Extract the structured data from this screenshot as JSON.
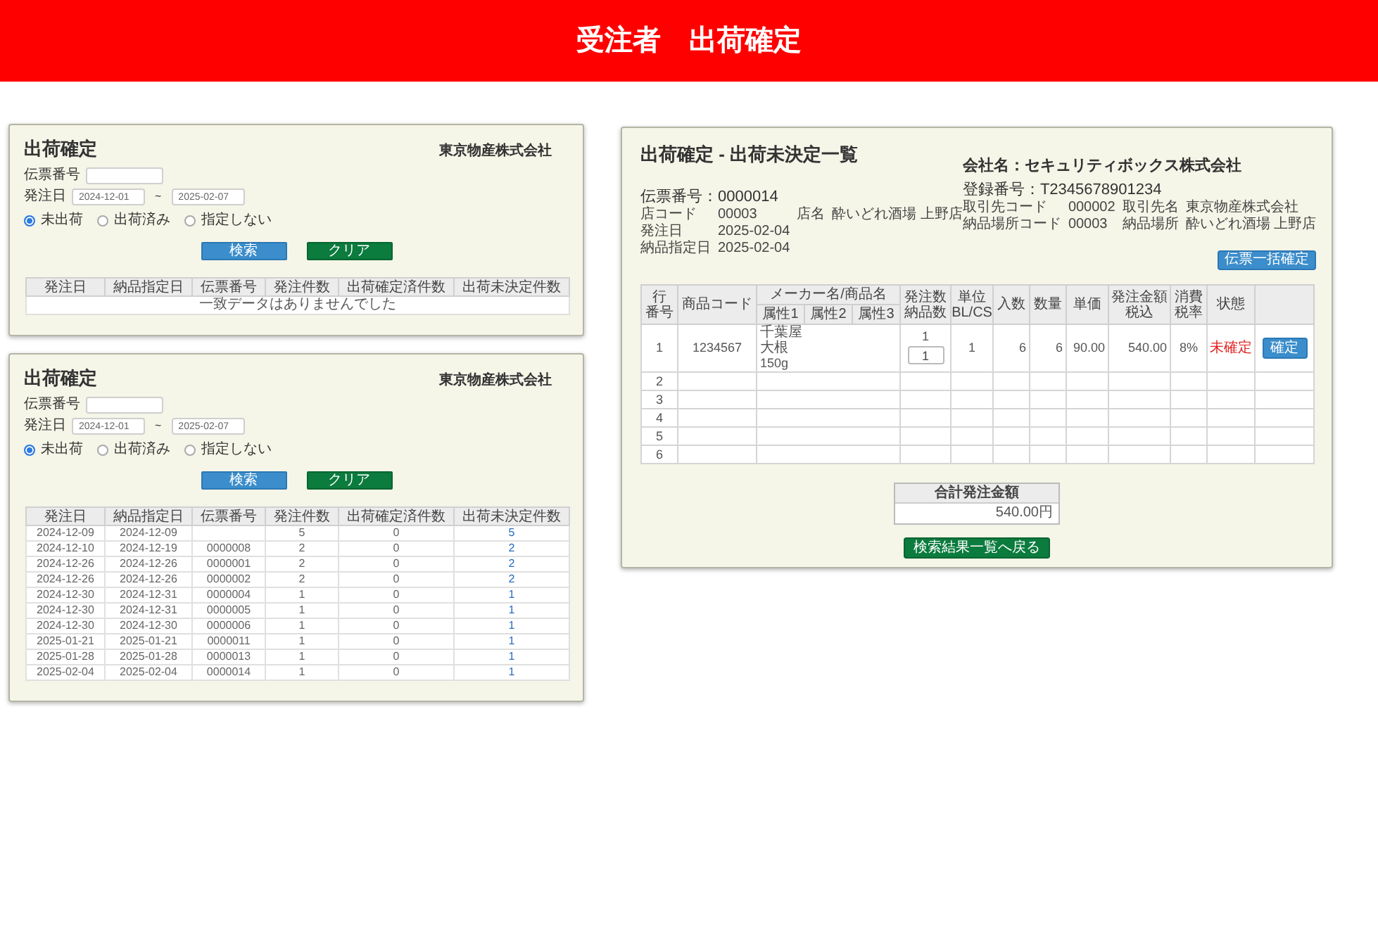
{
  "header": {
    "title": "受注者　出荷確定"
  },
  "search_screens": [
    {
      "title": "出荷確定",
      "company": "東京物産株式会社",
      "slip_field": {
        "label": "伝票番号"
      },
      "date_field": {
        "label": "発注日",
        "from": "2024-12-01",
        "separator": "~",
        "to": "2025-02-07"
      },
      "radio_options": [
        {
          "label": "未出荷",
          "selected": true
        },
        {
          "label": "出荷済み",
          "selected": false
        },
        {
          "label": "指定しない",
          "selected": false
        }
      ],
      "buttons": [
        {
          "label": "検索",
          "kind": "search"
        },
        {
          "label": "クリア",
          "kind": "clear"
        }
      ],
      "table": {
        "columns": [
          "発注日",
          "納品指定日",
          "伝票番号",
          "発注件数",
          "出荷確定済件数",
          "出荷未決定件数"
        ],
        "empty_message": "一致データはありませんでした"
      }
    },
    {
      "title": "出荷確定",
      "company": "東京物産株式会社",
      "slip_field": {
        "label": "伝票番号"
      },
      "date_field": {
        "label": "発注日",
        "from": "2024-12-01",
        "separator": "~",
        "to": "2025-02-07"
      },
      "radio_options": [
        {
          "label": "未出荷",
          "selected": true
        },
        {
          "label": "出荷済み",
          "selected": false
        },
        {
          "label": "指定しない",
          "selected": false
        }
      ],
      "buttons": [
        {
          "label": "検索",
          "kind": "search"
        },
        {
          "label": "クリア",
          "kind": "clear"
        }
      ],
      "table": {
        "columns": [
          "発注日",
          "納品指定日",
          "伝票番号",
          "発注件数",
          "出荷確定済件数",
          "出荷未決定件数"
        ],
        "rows": [
          {
            "order_date": "2024-12-09",
            "delivery_date": "2024-12-09",
            "order_count": "5",
            "confirmed_count": "0",
            "pending_count": "5"
          },
          {
            "order_date": "2024-12-10",
            "delivery_date": "2024-12-19",
            "slip_number": "0000008",
            "order_count": "2",
            "confirmed_count": "0",
            "pending_count": "2"
          },
          {
            "order_date": "2024-12-26",
            "delivery_date": "2024-12-26",
            "slip_number": "0000001",
            "order_count": "2",
            "confirmed_count": "0",
            "pending_count": "2"
          },
          {
            "order_date": "2024-12-26",
            "delivery_date": "2024-12-26",
            "slip_number": "0000002",
            "order_count": "2",
            "confirmed_count": "0",
            "pending_count": "2"
          },
          {
            "order_date": "2024-12-30",
            "delivery_date": "2024-12-31",
            "slip_number": "0000004",
            "order_count": "1",
            "confirmed_count": "0",
            "pending_count": "1"
          },
          {
            "order_date": "2024-12-30",
            "delivery_date": "2024-12-31",
            "slip_number": "0000005",
            "order_count": "1",
            "confirmed_count": "0",
            "pending_count": "1"
          },
          {
            "order_date": "2024-12-30",
            "delivery_date": "2024-12-30",
            "slip_number": "0000006",
            "order_count": "1",
            "confirmed_count": "0",
            "pending_count": "1"
          },
          {
            "order_date": "2025-01-21",
            "delivery_date": "2025-01-21",
            "slip_number": "0000011",
            "order_count": "1",
            "confirmed_count": "0",
            "pending_count": "1"
          },
          {
            "order_date": "2025-01-28",
            "delivery_date": "2025-01-28",
            "slip_number": "0000013",
            "order_count": "1",
            "confirmed_count": "0",
            "pending_count": "1"
          },
          {
            "order_date": "2025-02-04",
            "delivery_date": "2025-02-04",
            "slip_number": "0000014",
            "order_count": "1",
            "confirmed_count": "0",
            "pending_count": "1"
          }
        ]
      }
    }
  ],
  "detail_screen": {
    "title": "出荷確定 - 出荷未決定一覧",
    "slip_heading": "伝票番号：0000014",
    "info_left": [
      {
        "label": "店コード",
        "value": "00003",
        "label_2": "店名",
        "value_2": "酔いどれ酒場 上野店"
      },
      {
        "label": "発注日",
        "value": "2025-02-04"
      },
      {
        "label": "納品指定日",
        "value": "2025-02-04"
      }
    ],
    "company": "会社名：セキュリティボックス株式会社",
    "registration": "登録番号：T2345678901234",
    "info_right": [
      {
        "label": "取引先コード",
        "value": "000002",
        "label_2": "取引先名",
        "value_2": "東京物産株式会社"
      },
      {
        "label": "納品場所コード",
        "value": "00003",
        "label_2": "納品場所",
        "value_2": "酔いどれ酒場 上野店"
      }
    ],
    "bulk_button": "伝票一括確定",
    "table": {
      "columns": [
        {
          "lines": [
            "行",
            "番号"
          ]
        },
        {
          "lines": [
            "商品コード"
          ]
        },
        {
          "lines": [
            "メーカー名/商品名"
          ],
          "sub_columns": [
            "属性1",
            "属性2",
            "属性3"
          ]
        },
        {
          "lines": [
            "発注数",
            "納品数"
          ]
        },
        {
          "lines": [
            "単位",
            "BL/CS"
          ]
        },
        {
          "lines": [
            "入数"
          ]
        },
        {
          "lines": [
            "数量"
          ]
        },
        {
          "lines": [
            "単価"
          ]
        },
        {
          "lines": [
            "発注金額",
            "税込"
          ]
        },
        {
          "lines": [
            "消費",
            "税率"
          ]
        },
        {
          "lines": [
            "状態"
          ]
        }
      ],
      "rows": [
        {
          "row_number": "1",
          "product_code": "1234567",
          "maker": "千葉屋",
          "product_name": "大根",
          "spec": "150g",
          "order_quantity": "1",
          "delivery_quantity": "1",
          "unit": "1",
          "pack_size": "6",
          "quantity": "6",
          "unit_price": "90.00",
          "amount": "540.00",
          "tax_rate": "8%",
          "status": "未確定",
          "confirmed": false,
          "action": "確定"
        },
        {
          "row_number": "2"
        },
        {
          "row_number": "3"
        },
        {
          "row_number": "4"
        },
        {
          "row_number": "5"
        },
        {
          "row_number": "6"
        }
      ]
    },
    "total": {
      "label": "合計発注金額",
      "value": "540.00円"
    },
    "back_button": "検索結果一覧へ戻る"
  }
}
